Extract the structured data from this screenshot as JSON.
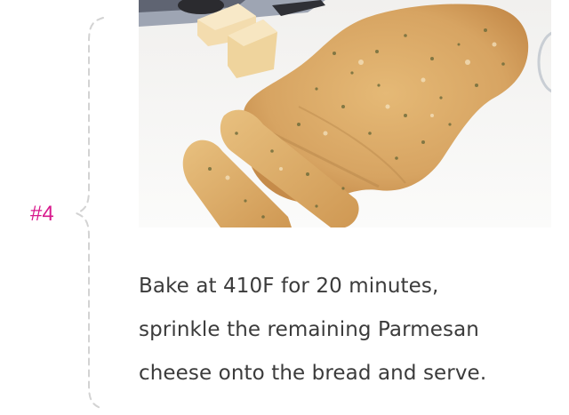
{
  "step": {
    "number": "#4",
    "lines": [
      "Bake at 410F for 20 minutes,",
      "sprinkle the remaining Parmesan",
      "cheese onto the bread and serve."
    ]
  },
  "photo": {
    "subject": "baked garlic parmesan flatbread sliced into sticks"
  },
  "colors": {
    "accent": "#d8198d",
    "text": "#3b3b3b",
    "connector": "#d3d3d3"
  }
}
